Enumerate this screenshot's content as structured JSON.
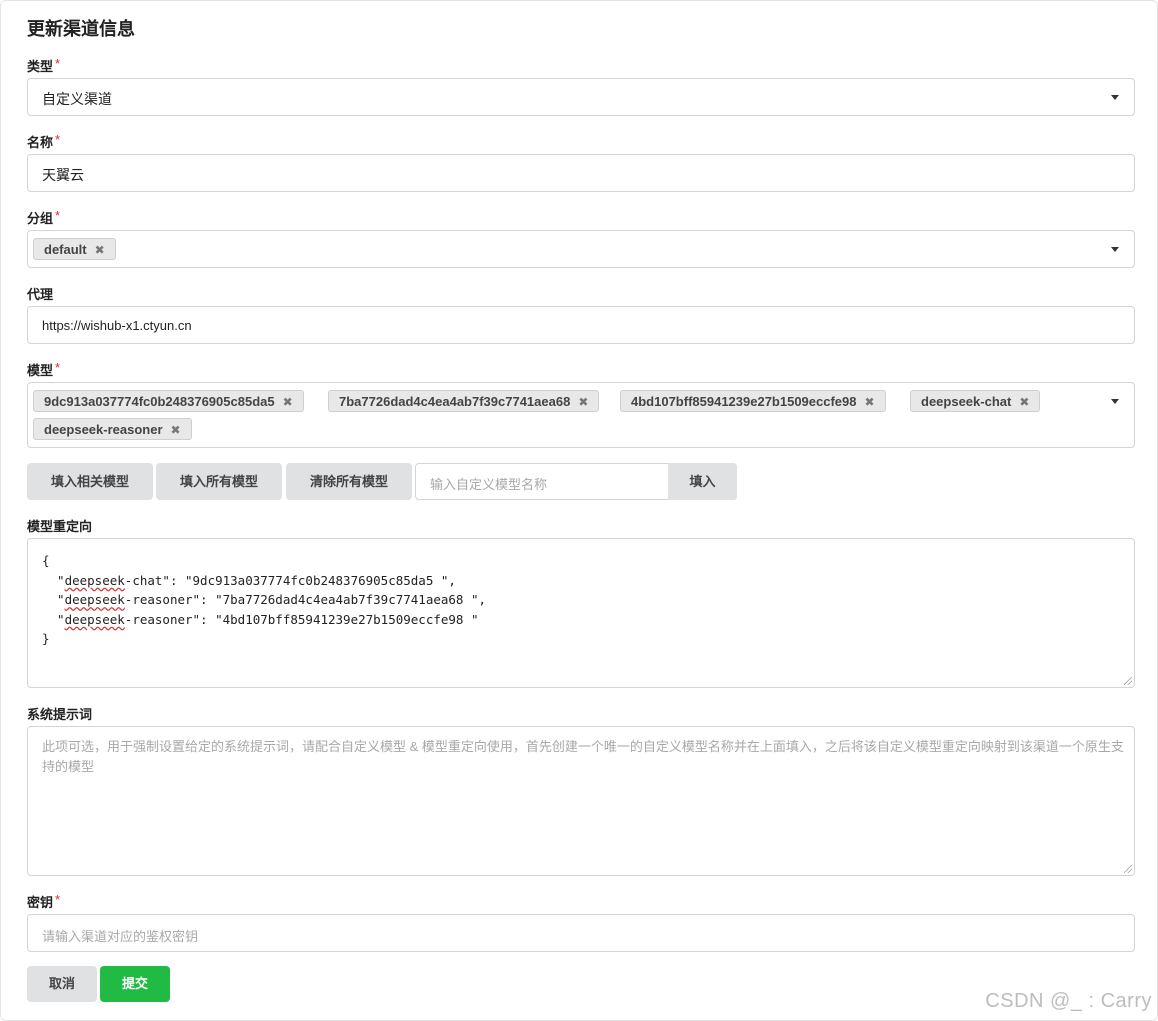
{
  "title": "更新渠道信息",
  "type_field": {
    "label": "类型",
    "required_mark": "*",
    "value": "自定义渠道"
  },
  "name_field": {
    "label": "名称",
    "required_mark": "*",
    "value": "天翼云"
  },
  "group_field": {
    "label": "分组",
    "required_mark": "*",
    "chips": [
      "default"
    ],
    "remove_glyph": "✖"
  },
  "proxy_field": {
    "label": "代理",
    "value": "https://wishub-x1.ctyun.cn"
  },
  "models_field": {
    "label": "模型",
    "required_mark": "*",
    "chips": [
      "9dc913a037774fc0b248376905c85da5",
      "7ba7726dad4c4ea4ab7f39c7741aea68",
      "4bd107bff85941239e27b1509eccfe98",
      "deepseek-chat",
      "deepseek-reasoner"
    ]
  },
  "model_actions": {
    "fill_related": "填入相关模型",
    "fill_all": "填入所有模型",
    "clear_all": "清除所有模型",
    "custom_placeholder": "输入自定义模型名称",
    "fill": "填入"
  },
  "model_mapping": {
    "label": "模型重定向",
    "lines": {
      "open": "{",
      "line1_pre": "  \"",
      "line1_key": "deepseek",
      "line1_post": "-chat\": \"9dc913a037774fc0b248376905c85da5 \",",
      "line2_pre": "  \"",
      "line2_key": "deepseek",
      "line2_post": "-reasoner\": \"7ba7726dad4c4ea4ab7f39c7741aea68 \",",
      "line3_pre": "  \"",
      "line3_key": "deepseek",
      "line3_post": "-reasoner\": \"4bd107bff85941239e27b1509eccfe98 \"",
      "close": "}"
    }
  },
  "system_prompt": {
    "label": "系统提示词",
    "placeholder": "此项可选，用于强制设置给定的系统提示词，请配合自定义模型 & 模型重定向使用，首先创建一个唯一的自定义模型名称并在上面填入，之后将该自定义模型重定向映射到该渠道一个原生支持的模型"
  },
  "key_field": {
    "label": "密钥",
    "required_mark": "*",
    "placeholder": "请输入渠道对应的鉴权密钥"
  },
  "footer": {
    "cancel": "取消",
    "submit": "提交"
  },
  "watermark": "CSDN @_ : Carry",
  "colors": {
    "submit": "#21ba45",
    "required": "#db2828",
    "button_gray": "#e0e1e2"
  },
  "icons": [
    "dropdown-caret-icon",
    "remove-chip-icon",
    "textarea-resize-icon"
  ]
}
